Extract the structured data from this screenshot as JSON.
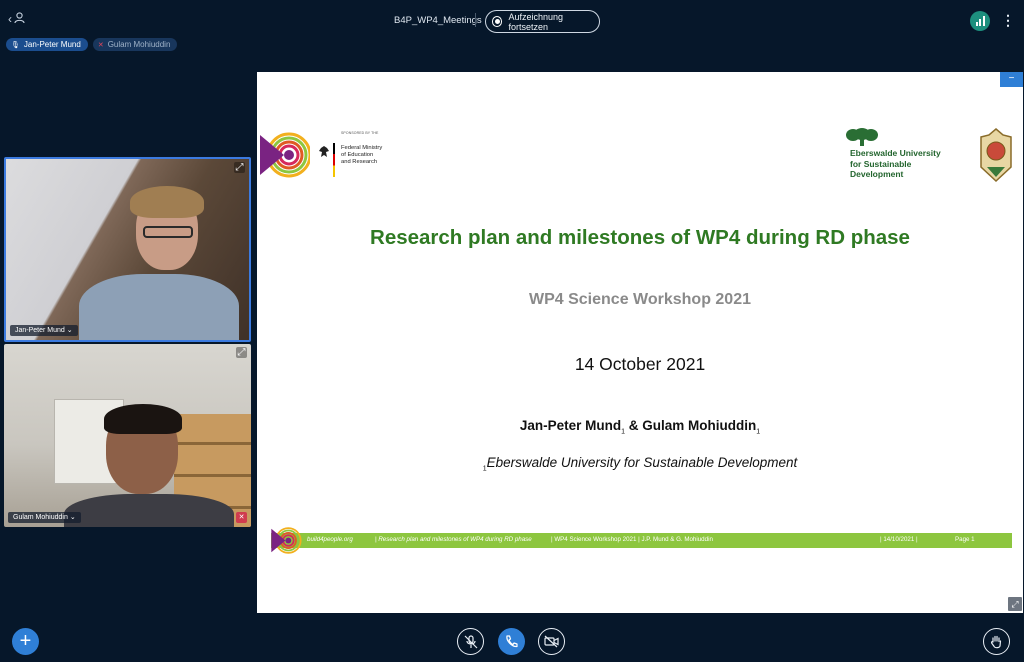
{
  "app": {
    "meeting_title": "B4P_WP4_Meetings",
    "recording_label": "Aufzeichnung fortsetzen"
  },
  "talkers": [
    {
      "name": "Jan-Peter Mund",
      "state": "active"
    },
    {
      "name": "Gulam Mohiuddin",
      "state": "muted"
    }
  ],
  "webcams": [
    {
      "name": "Jan-Peter Mund"
    },
    {
      "name": "Gulam Mohiuddin"
    }
  ],
  "slide": {
    "sponsor_caption": "SPONSORED BY THE",
    "sponsor_name": "Federal Ministry\nof Education\nand Research",
    "university_logo_text": "Eberswalde University\nfor Sustainable\nDevelopment",
    "title": "Research plan and milestones of WP4 during RD phase",
    "subtitle": "WP4 Science Workshop 2021",
    "date": "14 October 2021",
    "author1": "Jan-Peter Mund",
    "author2": "Gulam Mohiuddin",
    "author_sep": " & ",
    "superscript": "1",
    "affiliation": "Eberswalde University for Sustainable Development",
    "footer": {
      "site": "build4people.org",
      "title": "|    Research plan and milestones of WP4 during RD phase",
      "rest": "| WP4 Science Workshop 2021  | J.P. Mund & G. Mohiuddin",
      "date": "| 14/10/2021  |",
      "page": "Page 1"
    }
  },
  "colors": {
    "background": "#06172a",
    "accent": "#2f7fd6",
    "slide_title": "#2f7a23",
    "footer_bar": "#8dc63f",
    "muted": "#d03c4f"
  },
  "icons": {
    "leave": "leave-icon",
    "user_list": "user-icon",
    "connection": "connection-icon",
    "more": "more-icon",
    "plus": "plus-icon",
    "mic": "mic-muted-icon",
    "phone": "phone-icon",
    "camera": "camera-off-icon",
    "hand": "hand-icon"
  }
}
